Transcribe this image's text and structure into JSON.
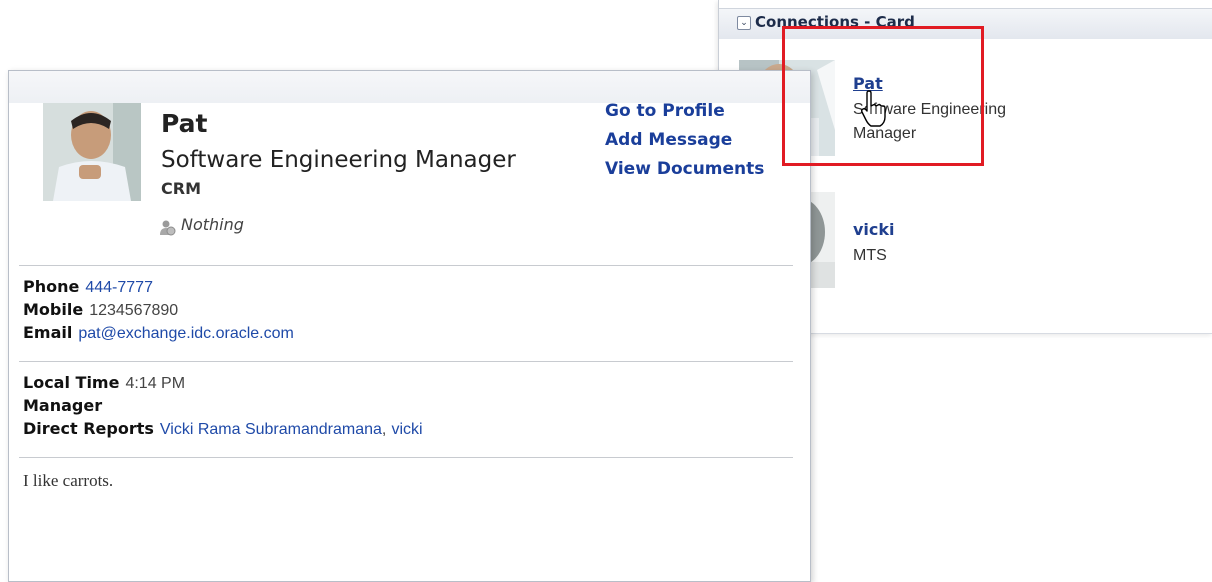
{
  "connections_panel": {
    "title": "Connections - Card",
    "toggle_icon": "chevron-down-icon",
    "items": [
      {
        "name": "Pat",
        "subtitle": "Software Engineering Manager"
      },
      {
        "name": "vicki",
        "subtitle": "MTS"
      }
    ]
  },
  "profile_card": {
    "name": "Pat",
    "title": "Software Engineering Manager",
    "department": "CRM",
    "status": "Nothing",
    "presence_icon": "presence-offline-icon",
    "actions": {
      "go_to_profile": "Go to Profile",
      "add_message": "Add Message",
      "view_documents": "View Documents"
    },
    "contact": {
      "phone_label": "Phone",
      "phone_value": "444-7777",
      "mobile_label": "Mobile",
      "mobile_value": "1234567890",
      "email_label": "Email",
      "email_value": "pat@exchange.idc.oracle.com"
    },
    "org": {
      "local_time_label": "Local Time",
      "local_time_value": "4:14 PM",
      "manager_label": "Manager",
      "direct_reports_label": "Direct Reports",
      "direct_report_1": "Vicki Rama Subramandramana",
      "separator": ",",
      "direct_report_2": "vicki"
    },
    "bio": "I like carrots."
  },
  "colors": {
    "link": "#1a3e9a",
    "highlight": "#e11b23"
  }
}
